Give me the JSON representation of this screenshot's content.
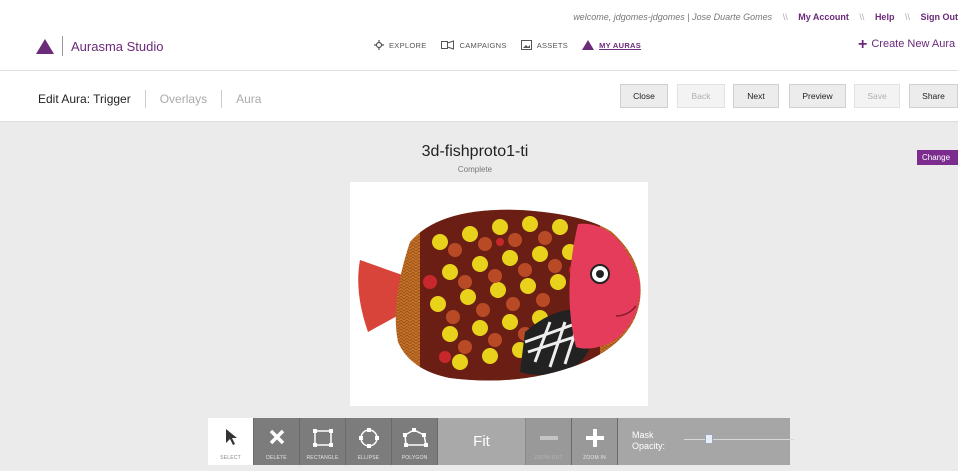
{
  "header": {
    "welcome_text": "welcome,",
    "username": "jdgomes-jdgomes",
    "display_name": "Jose Duarte Gomes",
    "separator": "\\\\",
    "links": [
      "My Account",
      "Help",
      "Sign Out"
    ],
    "logo_text": "Aurasma Studio",
    "nav": [
      {
        "label": "EXPLORE",
        "icon": "compass-icon"
      },
      {
        "label": "CAMPAIGNS",
        "icon": "campaigns-icon"
      },
      {
        "label": "ASSETS",
        "icon": "assets-icon"
      },
      {
        "label": "MY AURAS",
        "icon": "aurasma-icon"
      }
    ],
    "create_label": "Create New Aura"
  },
  "subbar": {
    "crumbs": [
      "Edit Aura: Trigger",
      "Overlays",
      "Aura"
    ],
    "buttons": [
      {
        "label": "Close",
        "enabled": true
      },
      {
        "label": "Back",
        "enabled": false
      },
      {
        "label": "Next",
        "enabled": true
      },
      {
        "label": "Preview",
        "enabled": true
      },
      {
        "label": "Save",
        "enabled": false
      },
      {
        "label": "Share",
        "enabled": true
      }
    ]
  },
  "trigger": {
    "name": "3d-fishproto1-ti",
    "status": "Complete",
    "change_label": "Change"
  },
  "toolbar": {
    "tools": [
      "SELECT",
      "DELETE",
      "RECTANGLE",
      "ELLIPSE",
      "POLYGON"
    ],
    "fit_label": "Fit",
    "zoom_out_label": "ZOOM OUT",
    "zoom_in_label": "ZOOM IN",
    "mask_label_1": "Mask",
    "mask_label_2": "Opacity:",
    "mask_opacity_fraction": 0.2
  },
  "colors": {
    "brand": "#6b2a7a",
    "change_button": "#7b2c8e"
  }
}
